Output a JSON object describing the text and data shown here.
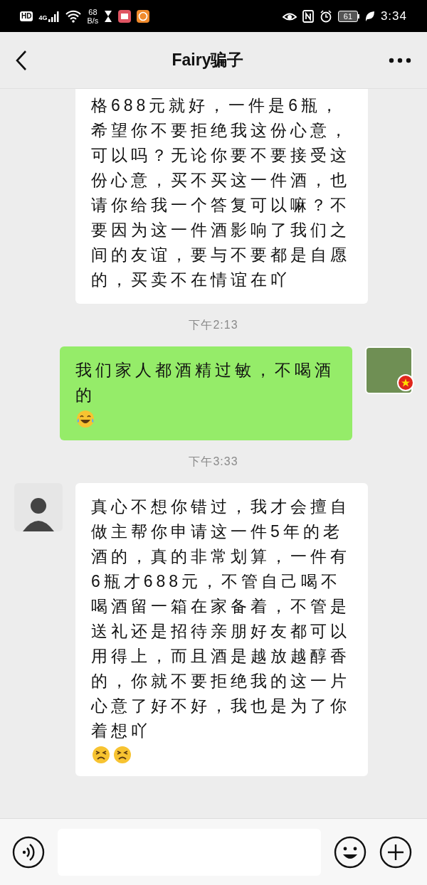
{
  "status_bar": {
    "hd": "HD",
    "network": "4G",
    "speed_value": "68",
    "speed_unit": "B/s",
    "battery": "61",
    "time": "3:34"
  },
  "header": {
    "title": "Fairy骗子"
  },
  "messages": [
    {
      "kind": "incoming",
      "text": "格688元就好，一件是6瓶，希望你不要拒绝我这份心意，可以吗？无论你要不要接受这份心意，买不买这一件酒，也请你给我一个答复可以嘛？不要因为这一件酒影响了我们之间的友谊，要与不要都是自愿的，买卖不在情谊在吖",
      "cut_top": true
    },
    {
      "kind": "time",
      "text": "下午2:13"
    },
    {
      "kind": "outgoing",
      "text": "我们家人都酒精过敏，不喝酒的",
      "emojis": [
        {
          "kind": "laughing"
        }
      ],
      "cut_top": false
    },
    {
      "kind": "time",
      "text": "下午3:33"
    },
    {
      "kind": "incoming",
      "text": "真心不想你错过，我才会擅自做主帮你申请这一件5年的老酒的，真的非常划算，一件有6瓶才688元，不管自己喝不喝酒留一箱在家备着，不管是送礼还是招待亲朋好友都可以用得上，而且酒是越放越醇香的，你就不要拒绝我的这一片心意了好不好，我也是为了你着想吖",
      "emojis": [
        {
          "kind": "frowning"
        },
        {
          "kind": "frowning"
        }
      ],
      "cut_top": false
    }
  ]
}
